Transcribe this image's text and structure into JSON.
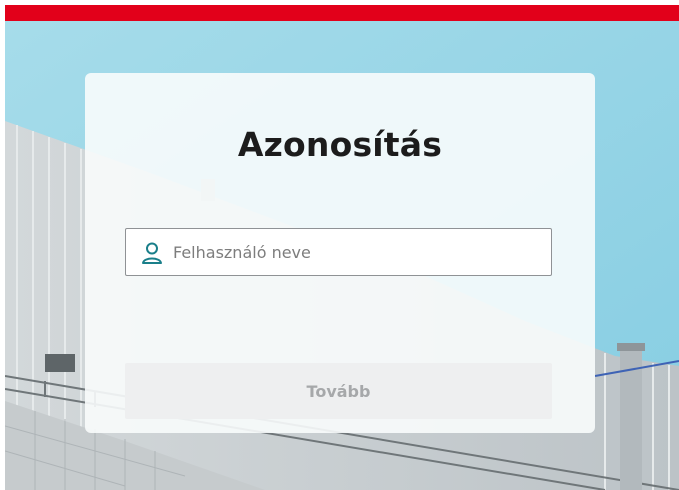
{
  "login": {
    "title": "Azonosítás",
    "username_placeholder": "Felhasználó neve",
    "username_value": "",
    "next_button_label": "Tovább",
    "next_button_enabled": false
  },
  "icons": {
    "username_field_icon": "user-icon"
  },
  "colors": {
    "brand_red": "#e2001a",
    "icon_teal": "#1a7f8a",
    "button_disabled_bg": "#eeeff0",
    "button_disabled_text": "#a6a8aa"
  }
}
